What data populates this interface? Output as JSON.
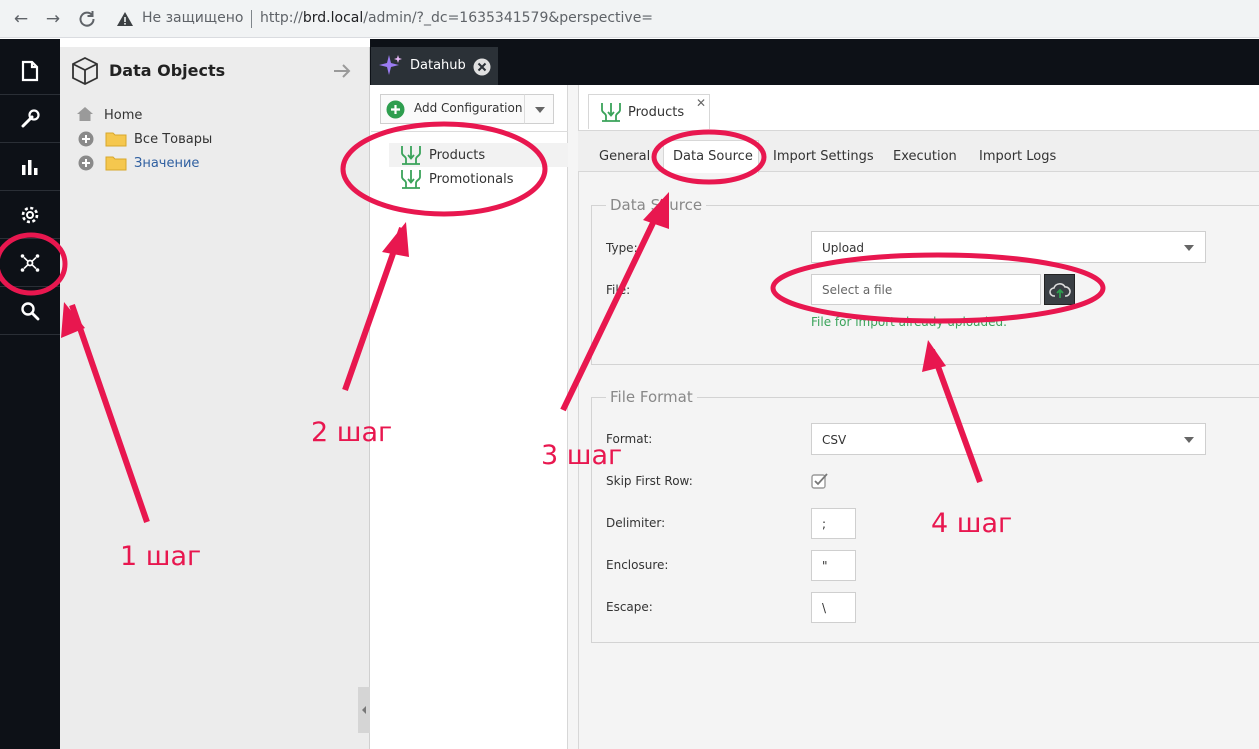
{
  "browser": {
    "security_label": "Не защищено",
    "url_host": "brd.local",
    "url_path": "/admin/?_dc=1635341579&perspective="
  },
  "tree": {
    "title": "Data Objects",
    "items": [
      {
        "label": "Home"
      },
      {
        "label": "Все Товары"
      },
      {
        "label": "Значение"
      }
    ]
  },
  "main_tab": {
    "label": "Datahub"
  },
  "config": {
    "add_label": "Add Configuration",
    "items": [
      {
        "label": "Products"
      },
      {
        "label": "Promotionals"
      }
    ]
  },
  "editor": {
    "tab_label": "Products",
    "subtabs": [
      "General",
      "Data Source",
      "Import Settings",
      "Execution",
      "Import Logs"
    ],
    "active_subtab": "Data Source",
    "data_source": {
      "legend": "Data Source",
      "type_label": "Type:",
      "type_value": "Upload",
      "file_label": "File:",
      "file_placeholder": "Select a file",
      "file_hint": "File for import already uploaded."
    },
    "file_format": {
      "legend": "File Format",
      "format_label": "Format:",
      "format_value": "CSV",
      "skip_label": "Skip First Row:",
      "skip_checked": true,
      "delimiter_label": "Delimiter:",
      "delimiter_value": ";",
      "enclosure_label": "Enclosure:",
      "enclosure_value": "\"",
      "escape_label": "Escape:",
      "escape_value": "\\"
    }
  },
  "annotations": {
    "step1": "1 шаг",
    "step2": "2 шаг",
    "step3": "3 шаг",
    "step4": "4 шаг",
    "color": "#e8174f"
  }
}
